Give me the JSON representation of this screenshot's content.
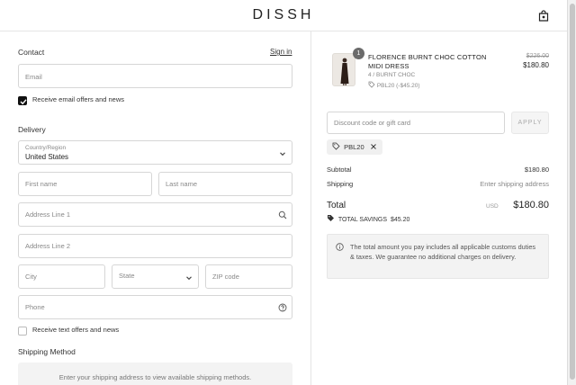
{
  "brand": {
    "logo": "DISSH"
  },
  "contact": {
    "heading": "Contact",
    "sign_in": "Sign in",
    "email_placeholder": "Email",
    "email_offers_label": "Receive email offers and news"
  },
  "delivery": {
    "heading": "Delivery",
    "country_label": "Country/Region",
    "country_value": "United States",
    "first_name_placeholder": "First name",
    "last_name_placeholder": "Last name",
    "address1_placeholder": "Address Line 1",
    "address2_placeholder": "Address Line 2",
    "city_placeholder": "City",
    "state_placeholder": "State",
    "zip_placeholder": "ZIP code",
    "phone_placeholder": "Phone",
    "text_offers_label": "Receive text offers and news"
  },
  "shipping_method": {
    "heading": "Shipping Method",
    "message": "Enter your shipping address to view available shipping methods."
  },
  "order": {
    "quantity": "1",
    "product_name": "FLORENCE BURNT CHOC COTTON MIDI DRESS",
    "variant": "4 / BURNT CHOC",
    "discount_line": "PBL20 (-$45.20)",
    "price_original": "$226.00",
    "price_final": "$180.80"
  },
  "discount": {
    "placeholder": "Discount code or gift card",
    "apply_label": "APPLY",
    "applied_code": "PBL20"
  },
  "summary": {
    "subtotal_label": "Subtotal",
    "subtotal_value": "$180.80",
    "shipping_label": "Shipping",
    "shipping_value": "Enter shipping address",
    "total_label": "Total",
    "total_currency": "USD",
    "total_value": "$180.80",
    "savings_label": "TOTAL SAVINGS",
    "savings_value": "$45.20"
  },
  "notice": {
    "text": "The total amount you pay includes all applicable customs duties & taxes. We guarantee no additional charges on delivery."
  }
}
